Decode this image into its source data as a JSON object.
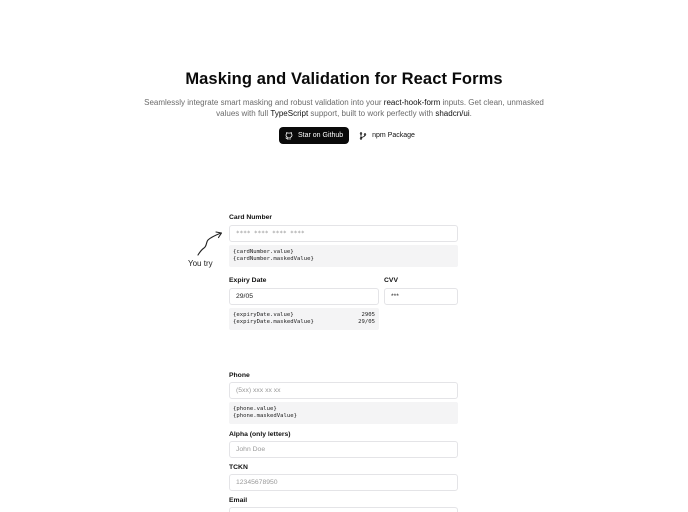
{
  "hero": {
    "title": "Masking and Validation for React Forms",
    "desc_prefix": "Seamlessly integrate smart masking and robust validation into your ",
    "desc_rhf": "react-hook-form",
    "desc_mid": " inputs. Get clean, unmasked values with full ",
    "desc_ts": "TypeScript",
    "desc_mid2": " support, built to work perfectly with ",
    "desc_shadcn": "shadcn/ui",
    "desc_end": "."
  },
  "buttons": {
    "github_label": "Star on Github",
    "npm_label": "npm Package"
  },
  "annotation": {
    "you_try": "You try"
  },
  "card": {
    "label": "Card Number",
    "placeholder": "**** **** **** ****",
    "code_value": "{cardNumber.value}",
    "code_masked": "{cardNumber.maskedValue}"
  },
  "expiry": {
    "label": "Expiry Date",
    "value": "29/05",
    "code_value": "{expiryDate.value}",
    "code_value_result": "2905",
    "code_masked": "{expiryDate.maskedValue}",
    "code_masked_result": "29/05"
  },
  "cvv": {
    "label": "CVV",
    "value": "***"
  },
  "phone": {
    "label": "Phone",
    "placeholder": "(5xx) xxx xx xx",
    "code_value": "{phone.value}",
    "code_masked": "{phone.maskedValue}"
  },
  "alpha": {
    "label": "Alpha (only letters)",
    "placeholder": "John Doe"
  },
  "tckn": {
    "label": "TCKN",
    "placeholder": "12345678950"
  },
  "email": {
    "label": "Email"
  },
  "icons": [
    "github-icon",
    "git-branch-icon",
    "curved-arrow-icon"
  ],
  "colors": {
    "primary": "#0a0a0a",
    "muted_text": "#6b6b6b",
    "code_bg": "#f4f4f5",
    "border": "#e4e4e7"
  }
}
